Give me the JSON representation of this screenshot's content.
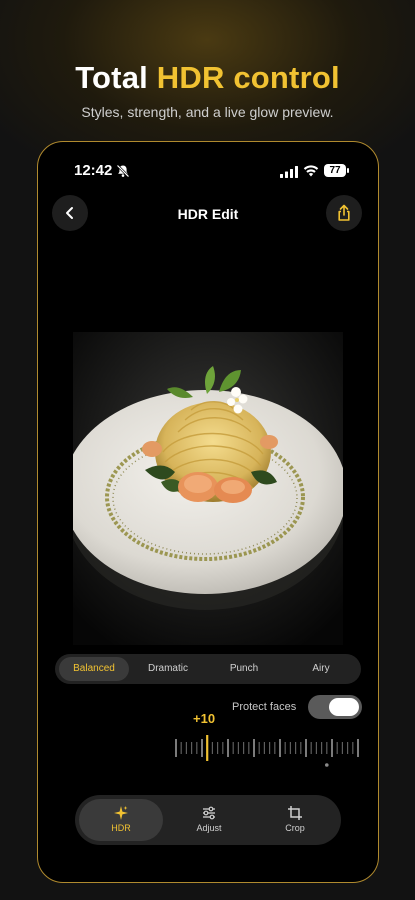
{
  "headline": {
    "part1": "Total ",
    "accent": "HDR control"
  },
  "subheadline": "Styles, strength, and a live glow preview.",
  "status_bar": {
    "time": "12:42",
    "battery": "77"
  },
  "nav": {
    "title": "HDR Edit"
  },
  "styles": {
    "selected": "Balanced",
    "options": [
      "Balanced",
      "Dramatic",
      "Punch",
      "Airy"
    ]
  },
  "protect_faces": {
    "label": "Protect faces",
    "on": true
  },
  "strength": {
    "value": "+10"
  },
  "tabbar": {
    "items": [
      {
        "label": "HDR",
        "icon": "sparkle-icon",
        "active": true
      },
      {
        "label": "Adjust",
        "icon": "sliders-icon",
        "active": false
      },
      {
        "label": "Crop",
        "icon": "crop-icon",
        "active": false
      }
    ]
  },
  "colors": {
    "accent": "#f1c232",
    "background": "#121212",
    "phone_border": "#b08a2e"
  }
}
